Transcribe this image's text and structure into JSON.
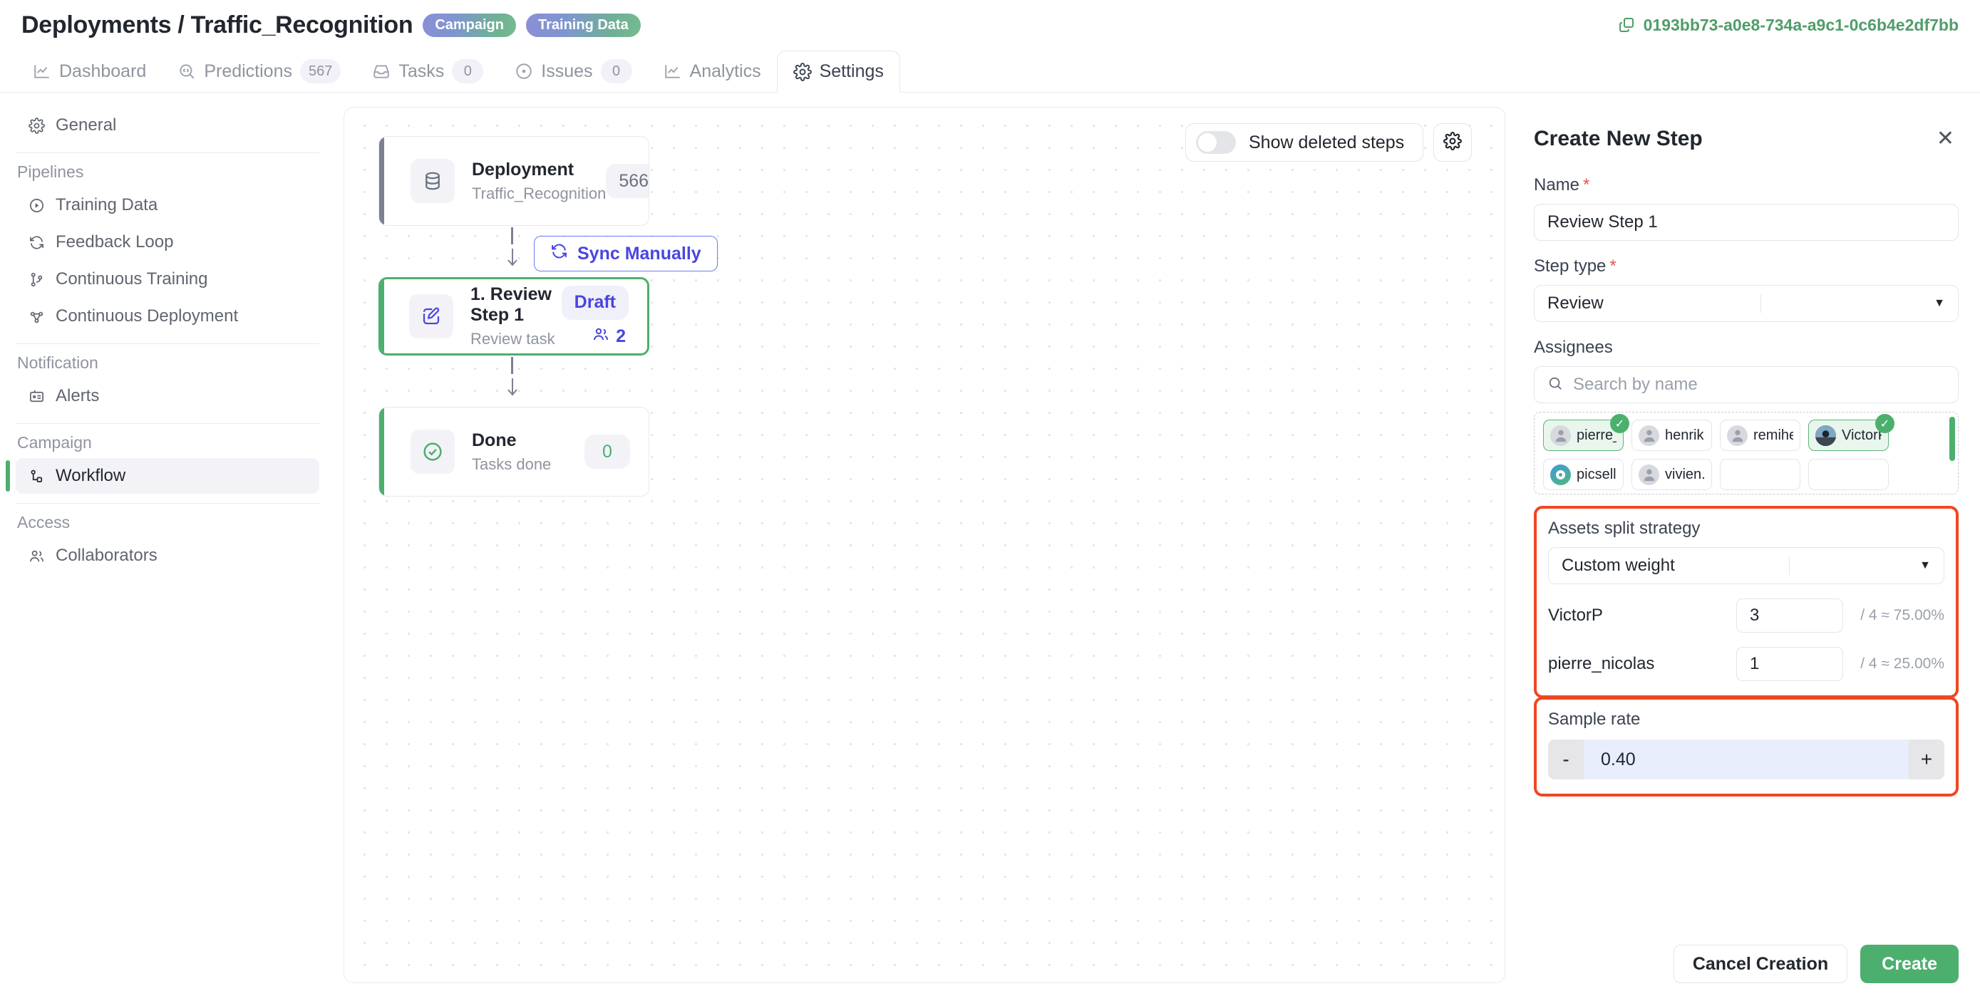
{
  "header": {
    "breadcrumb": "Deployments / Traffic_Recognition",
    "badges": [
      {
        "label": "Campaign"
      },
      {
        "label": "Training Data"
      }
    ],
    "deployment_id": "0193bb73-a0e8-734a-a9c1-0c6b4e2df7bb",
    "copy_icon": "copy-icon"
  },
  "tabs": [
    {
      "label": "Dashboard",
      "icon": "chart-line-icon",
      "count": null,
      "active": false
    },
    {
      "label": "Predictions",
      "icon": "prediction-scan-icon",
      "count": "567",
      "active": false
    },
    {
      "label": "Tasks",
      "icon": "inbox-icon",
      "count": "0",
      "active": false
    },
    {
      "label": "Issues",
      "icon": "target-dot-icon",
      "count": "0",
      "active": false
    },
    {
      "label": "Analytics",
      "icon": "chart-line-icon",
      "count": null,
      "active": false
    },
    {
      "label": "Settings",
      "icon": "gear-icon",
      "count": null,
      "active": true
    }
  ],
  "sidebar": {
    "general": {
      "label": "General",
      "icon": "gear-icon"
    },
    "groups": [
      {
        "title": "Pipelines",
        "items": [
          {
            "label": "Training Data",
            "icon": "play-circle-icon"
          },
          {
            "label": "Feedback Loop",
            "icon": "refresh-loop-icon"
          },
          {
            "label": "Continuous Training",
            "icon": "git-branch-icon"
          },
          {
            "label": "Continuous Deployment",
            "icon": "deployment-nodes-icon"
          }
        ]
      },
      {
        "title": "Notification",
        "items": [
          {
            "label": "Alerts",
            "icon": "id-card-icon"
          }
        ]
      },
      {
        "title": "Campaign",
        "items": [
          {
            "label": "Workflow",
            "icon": "workflow-nodes-icon",
            "active": true
          }
        ]
      },
      {
        "title": "Access",
        "items": [
          {
            "label": "Collaborators",
            "icon": "users-icon"
          }
        ]
      }
    ]
  },
  "canvas": {
    "toolbar": {
      "show_deleted_steps_label": "Show deleted steps",
      "show_deleted_steps_on": false,
      "settings_icon": "gear-icon"
    },
    "sync_button_label": "Sync Manually",
    "sync_button_icon": "refresh-loop-icon",
    "steps": [
      {
        "title": "Deployment",
        "subtitle": "Traffic_Recognition",
        "icon": "database-icon",
        "accent_color": "#7c8191",
        "count": "566"
      },
      {
        "title": "1. Review Step 1",
        "subtitle": "Review task",
        "icon": "edit-square-icon",
        "accent_color": "#4caf6e",
        "status": "Draft",
        "assignees_count": "2",
        "assignees_icon": "users-icon",
        "selected": true
      },
      {
        "title": "Done",
        "subtitle": "Tasks done",
        "icon": "check-circle-icon",
        "accent_color": "#4caf6e",
        "count": "0"
      }
    ]
  },
  "panel": {
    "title": "Create New Step",
    "close_icon": "close-icon",
    "name_label": "Name",
    "name_value": "Review Step 1",
    "step_type_label": "Step type",
    "step_type_value": "Review",
    "assignees_label": "Assignees",
    "search_placeholder": "Search by name",
    "search_icon": "search-icon",
    "assignees": [
      {
        "name": "pierre_...",
        "selected": true,
        "avatar": "default"
      },
      {
        "name": "henrik....",
        "selected": false,
        "avatar": "default"
      },
      {
        "name": "remihe...",
        "selected": false,
        "avatar": "default"
      },
      {
        "name": "VictorP",
        "selected": true,
        "avatar": "photo"
      },
      {
        "name": "picselli...",
        "selected": false,
        "avatar": "logo"
      },
      {
        "name": "vivien.r...",
        "selected": false,
        "avatar": "default"
      }
    ],
    "split_strategy_label": "Assets split strategy",
    "split_strategy_value": "Custom weight",
    "weights": [
      {
        "name": "VictorP",
        "value": "3",
        "fraction": "/ 4 ≈ 75.00%"
      },
      {
        "name": "pierre_nicolas",
        "value": "1",
        "fraction": "/ 4 ≈ 25.00%"
      }
    ],
    "sample_rate_label": "Sample rate",
    "sample_rate_value": "0.40",
    "sample_rate_minus": "-",
    "sample_rate_plus": "+",
    "cancel_label": "Cancel Creation",
    "create_label": "Create"
  },
  "colors": {
    "accent_green": "#4caf6e",
    "accent_indigo": "#4a46e0",
    "highlight_red": "#ef4723"
  }
}
